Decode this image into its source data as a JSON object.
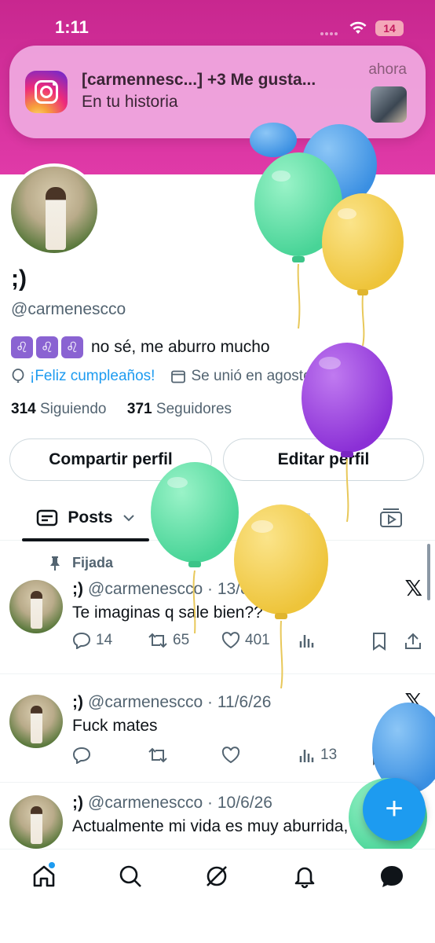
{
  "status_bar": {
    "time": "1:11",
    "battery": "14"
  },
  "notification": {
    "app_icon": "instagram-icon",
    "title": "[carmennesc...] +3 Me gusta...",
    "body": "En tu historia",
    "time": "ahora"
  },
  "profile": {
    "display_name": ";)",
    "handle": "@carmenescco",
    "bio_emoji": "♌",
    "bio_text": "no sé, me aburro mucho",
    "birthday_link": "¡Feliz cumpleaños!",
    "joined": "Se unió en agosto de 2021",
    "following_count": "314",
    "following_label": "Siguiendo",
    "followers_count": "371",
    "followers_label": "Seguidores",
    "share_button": "Compartir perfil",
    "edit_button": "Editar perfil"
  },
  "tabs": {
    "posts_label": "Posts"
  },
  "pinned_label": "Fijada",
  "posts": [
    {
      "name": ";)",
      "handle": "@carmenescco",
      "date": "· 13/8/22",
      "text": "Te imaginas q sale bien??",
      "replies": "14",
      "reposts": "65",
      "likes": "401",
      "views": ""
    },
    {
      "name": ";)",
      "handle": "@carmenescco",
      "date": "· 11/6/26",
      "text": "Fuck mates",
      "replies": "",
      "reposts": "",
      "likes": "",
      "views": "13"
    },
    {
      "name": ";)",
      "handle": "@carmenescco",
      "date": "· 10/6/26",
      "text": "Actualmente mi vida es muy aburrida,"
    }
  ],
  "fab_label": "+",
  "colors": {
    "accent": "#1d9bf0",
    "header": "#d62f9a",
    "balloon_green": "#5fe0a6",
    "balloon_blue": "#4fa3ea",
    "balloon_yellow": "#f3cf4c",
    "balloon_purple": "#9b42e0"
  }
}
